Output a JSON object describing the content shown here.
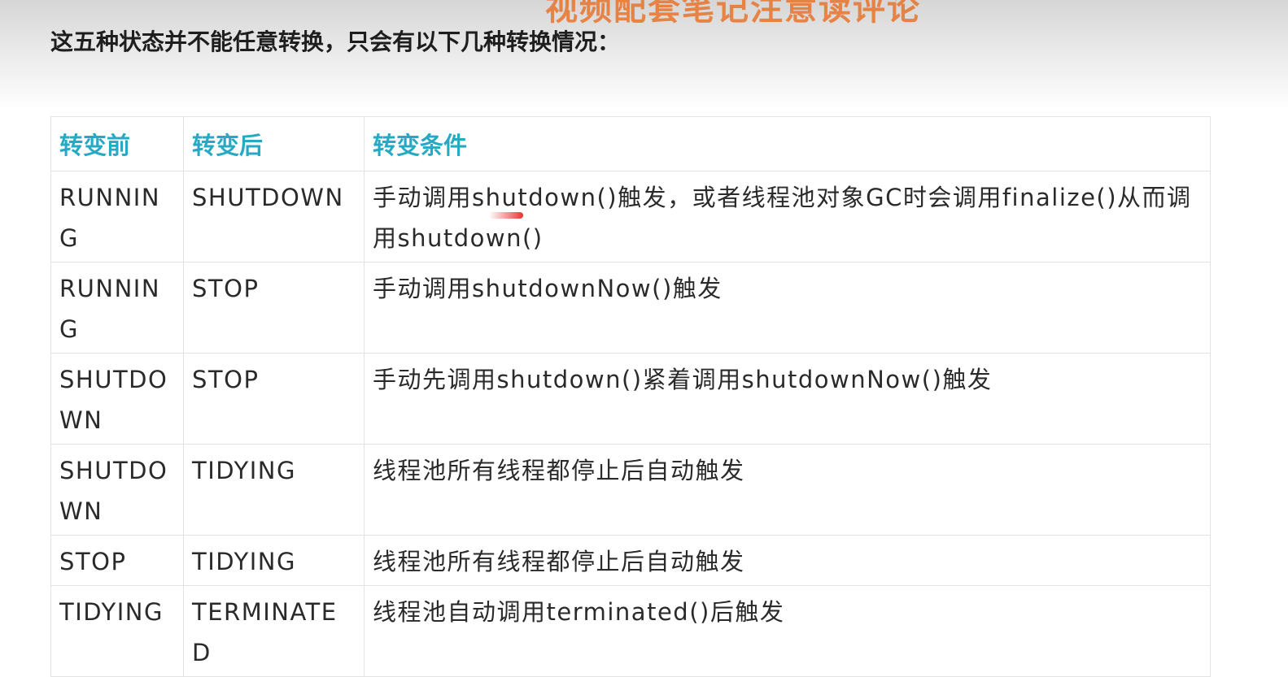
{
  "watermark_text": "视频配套笔记注意读评论",
  "intro_text": "这五种状态并不能任意转换，只会有以下几种转换情况：",
  "table": {
    "headers": [
      "转变前",
      "转变后",
      "转变条件"
    ],
    "rows": [
      [
        "RUNNING",
        "SHUTDOWN",
        "手动调用shutdown()触发，或者线程池对象GC时会调用finalize()从而调用shutdown()"
      ],
      [
        "RUNNING",
        "STOP",
        "手动调用shutdownNow()触发"
      ],
      [
        "SHUTDOWN",
        "STOP",
        "手动先调用shutdown()紧着调用shutdownNow()触发"
      ],
      [
        "SHUTDOWN",
        "TIDYING",
        "线程池所有线程都停止后自动触发"
      ],
      [
        "STOP",
        "TIDYING",
        "线程池所有线程都停止后自动触发"
      ],
      [
        "TIDYING",
        "TERMINATED",
        "线程池自动调用terminated()后触发"
      ]
    ]
  },
  "colors": {
    "header_text": "#27a9c4",
    "watermark": "#e8742c",
    "border": "#e3e3e3"
  }
}
